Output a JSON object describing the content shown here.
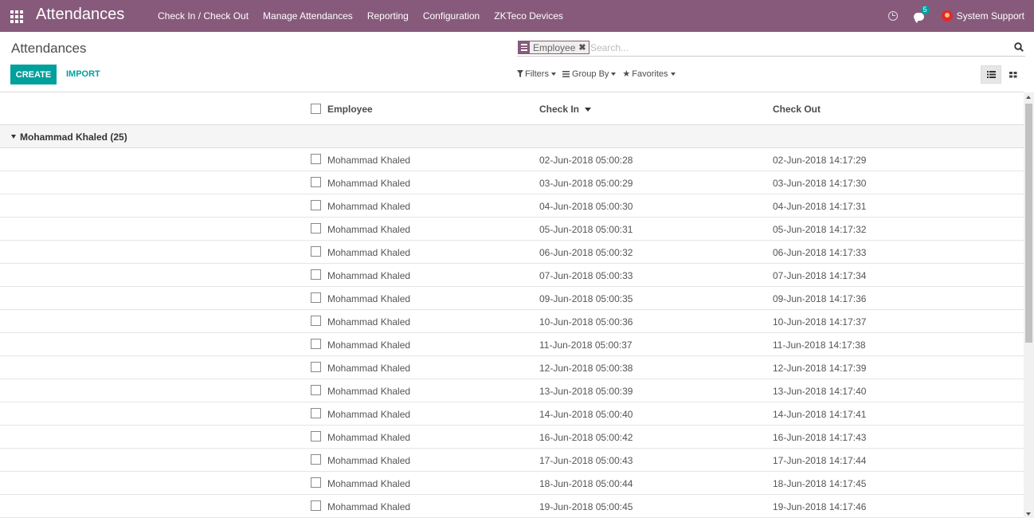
{
  "navbar": {
    "app_title": "Attendances",
    "menu": [
      "Check In / Check Out",
      "Manage Attendances",
      "Reporting",
      "Configuration",
      "ZKTeco Devices"
    ],
    "messages_count": "5",
    "user_name": "System Support",
    "bg_color": "#875a7b"
  },
  "control_panel": {
    "breadcrumb": "Attendances",
    "create_label": "CREATE",
    "import_label": "IMPORT",
    "search": {
      "facet": "Employee",
      "placeholder": "Search..."
    },
    "filters_label": "Filters",
    "group_by_label": "Group By",
    "favorites_label": "Favorites",
    "accent_color": "#00a09d"
  },
  "list": {
    "columns": [
      "Employee",
      "Check In",
      "Check Out"
    ],
    "sorted_column": "Check In",
    "group_label": "Mohammad Khaled (25)",
    "rows": [
      {
        "employee": "Mohammad Khaled",
        "check_in": "02-Jun-2018 05:00:28",
        "check_out": "02-Jun-2018 14:17:29"
      },
      {
        "employee": "Mohammad Khaled",
        "check_in": "03-Jun-2018 05:00:29",
        "check_out": "03-Jun-2018 14:17:30"
      },
      {
        "employee": "Mohammad Khaled",
        "check_in": "04-Jun-2018 05:00:30",
        "check_out": "04-Jun-2018 14:17:31"
      },
      {
        "employee": "Mohammad Khaled",
        "check_in": "05-Jun-2018 05:00:31",
        "check_out": "05-Jun-2018 14:17:32"
      },
      {
        "employee": "Mohammad Khaled",
        "check_in": "06-Jun-2018 05:00:32",
        "check_out": "06-Jun-2018 14:17:33"
      },
      {
        "employee": "Mohammad Khaled",
        "check_in": "07-Jun-2018 05:00:33",
        "check_out": "07-Jun-2018 14:17:34"
      },
      {
        "employee": "Mohammad Khaled",
        "check_in": "09-Jun-2018 05:00:35",
        "check_out": "09-Jun-2018 14:17:36"
      },
      {
        "employee": "Mohammad Khaled",
        "check_in": "10-Jun-2018 05:00:36",
        "check_out": "10-Jun-2018 14:17:37"
      },
      {
        "employee": "Mohammad Khaled",
        "check_in": "11-Jun-2018 05:00:37",
        "check_out": "11-Jun-2018 14:17:38"
      },
      {
        "employee": "Mohammad Khaled",
        "check_in": "12-Jun-2018 05:00:38",
        "check_out": "12-Jun-2018 14:17:39"
      },
      {
        "employee": "Mohammad Khaled",
        "check_in": "13-Jun-2018 05:00:39",
        "check_out": "13-Jun-2018 14:17:40"
      },
      {
        "employee": "Mohammad Khaled",
        "check_in": "14-Jun-2018 05:00:40",
        "check_out": "14-Jun-2018 14:17:41"
      },
      {
        "employee": "Mohammad Khaled",
        "check_in": "16-Jun-2018 05:00:42",
        "check_out": "16-Jun-2018 14:17:43"
      },
      {
        "employee": "Mohammad Khaled",
        "check_in": "17-Jun-2018 05:00:43",
        "check_out": "17-Jun-2018 14:17:44"
      },
      {
        "employee": "Mohammad Khaled",
        "check_in": "18-Jun-2018 05:00:44",
        "check_out": "18-Jun-2018 14:17:45"
      },
      {
        "employee": "Mohammad Khaled",
        "check_in": "19-Jun-2018 05:00:45",
        "check_out": "19-Jun-2018 14:17:46"
      }
    ]
  }
}
